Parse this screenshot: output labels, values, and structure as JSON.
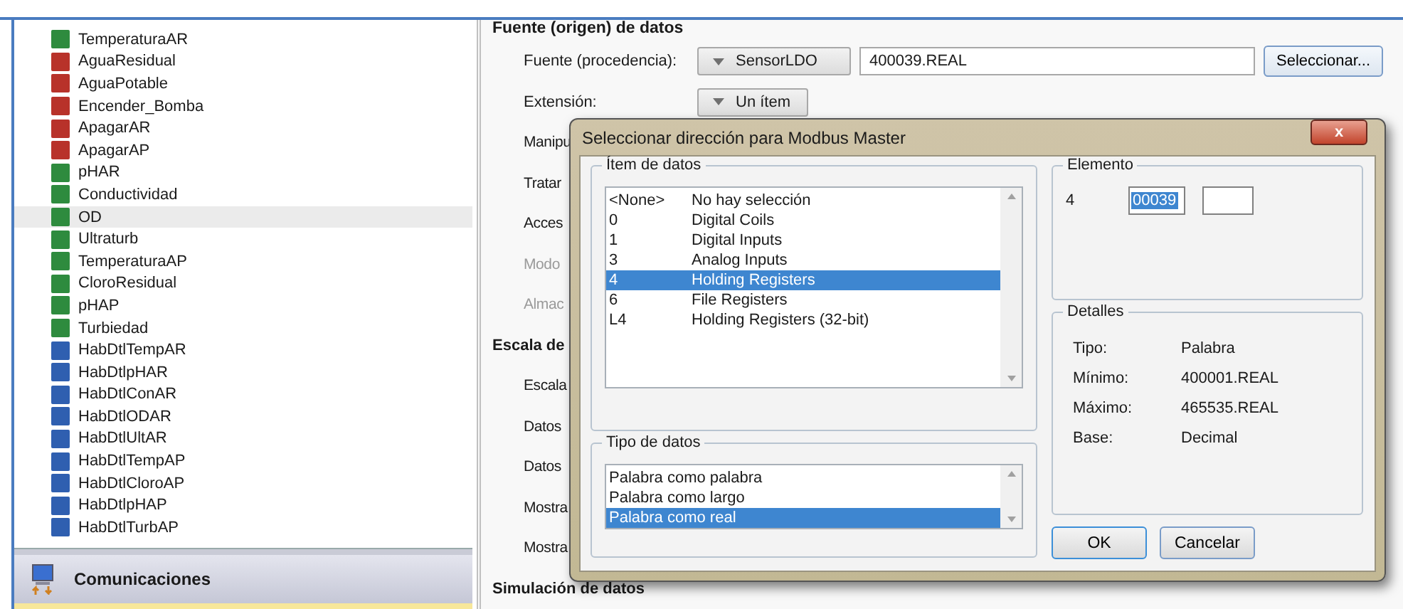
{
  "tree": {
    "items": [
      {
        "label": "TemperaturaAR",
        "kind": "analog",
        "selected": false
      },
      {
        "label": "AguaResidual",
        "kind": "digital",
        "selected": false
      },
      {
        "label": "AguaPotable",
        "kind": "digital",
        "selected": false
      },
      {
        "label": "Encender_Bomba",
        "kind": "digital",
        "selected": false
      },
      {
        "label": "ApagarAR",
        "kind": "digital",
        "selected": false
      },
      {
        "label": "ApagarAP",
        "kind": "digital",
        "selected": false
      },
      {
        "label": "pHAR",
        "kind": "analog",
        "selected": false
      },
      {
        "label": "Conductividad",
        "kind": "analog",
        "selected": false
      },
      {
        "label": "OD",
        "kind": "analog",
        "selected": true
      },
      {
        "label": "Ultraturb",
        "kind": "analog",
        "selected": false
      },
      {
        "label": "TemperaturaAP",
        "kind": "analog",
        "selected": false
      },
      {
        "label": "CloroResidual",
        "kind": "analog",
        "selected": false
      },
      {
        "label": "pHAP",
        "kind": "analog",
        "selected": false
      },
      {
        "label": "Turbiedad",
        "kind": "analog",
        "selected": false
      },
      {
        "label": "HabDtlTempAR",
        "kind": "enable",
        "selected": false
      },
      {
        "label": "HabDtlpHAR",
        "kind": "enable",
        "selected": false
      },
      {
        "label": "HabDtlConAR",
        "kind": "enable",
        "selected": false
      },
      {
        "label": "HabDtlODAR",
        "kind": "enable",
        "selected": false
      },
      {
        "label": "HabDtlUltAR",
        "kind": "enable",
        "selected": false
      },
      {
        "label": "HabDtlTempAP",
        "kind": "enable",
        "selected": false
      },
      {
        "label": "HabDtlCloroAP",
        "kind": "enable",
        "selected": false
      },
      {
        "label": "HabDtlpHAP",
        "kind": "enable",
        "selected": false
      },
      {
        "label": "HabDtlTurbAP",
        "kind": "enable",
        "selected": false
      }
    ],
    "section": "Comunicaciones"
  },
  "form": {
    "heading": "Fuente (origen) de datos",
    "source_label": "Fuente (procedencia):",
    "source_dropdown": "SensorLDO",
    "source_value": "400039.REAL",
    "select_button": "Seleccionar...",
    "extension_label": "Extensión:",
    "extension_dropdown": "Un ítem",
    "rows": [
      {
        "label": "Manipu",
        "kind": "label",
        "disabled": false
      },
      {
        "label": "Tratar",
        "kind": "label",
        "disabled": false
      },
      {
        "label": "Acces",
        "kind": "label",
        "disabled": false
      },
      {
        "label": "Modo",
        "kind": "label",
        "disabled": true
      },
      {
        "label": "Almac",
        "kind": "label",
        "disabled": true
      },
      {
        "label": "Escala de",
        "kind": "heading",
        "disabled": false
      },
      {
        "label": "Escala",
        "kind": "label",
        "disabled": false
      },
      {
        "label": "Datos",
        "kind": "label",
        "disabled": false
      },
      {
        "label": "Datos",
        "kind": "label",
        "disabled": false
      },
      {
        "label": "Mostra",
        "kind": "label",
        "disabled": false
      },
      {
        "label": "Mostra",
        "kind": "label",
        "disabled": false
      },
      {
        "label": "Simulación de datos",
        "kind": "heading",
        "disabled": false
      }
    ]
  },
  "dialog": {
    "title": "Seleccionar dirección para Modbus Master",
    "close": "x",
    "data_items": {
      "title": "Ítem de datos",
      "items": [
        {
          "code": "<None>",
          "name": "No hay selección",
          "selected": false
        },
        {
          "code": "0",
          "name": "Digital Coils",
          "selected": false
        },
        {
          "code": "1",
          "name": "Digital Inputs",
          "selected": false
        },
        {
          "code": "3",
          "name": "Analog Inputs",
          "selected": false
        },
        {
          "code": "4",
          "name": "Holding Registers",
          "selected": true
        },
        {
          "code": "6",
          "name": "File Registers",
          "selected": false
        },
        {
          "code": "L4",
          "name": "Holding Registers (32-bit)",
          "selected": false
        }
      ]
    },
    "data_type": {
      "title": "Tipo de datos",
      "items": [
        {
          "label": "Palabra como palabra",
          "selected": false
        },
        {
          "label": "Palabra como largo",
          "selected": false
        },
        {
          "label": "Palabra como real",
          "selected": true
        }
      ]
    },
    "element": {
      "title": "Elemento",
      "prefix": "4",
      "value": "00039"
    },
    "details": {
      "title": "Detalles",
      "rows": [
        {
          "label": "Tipo:",
          "value": "Palabra"
        },
        {
          "label": "Mínimo:",
          "value": "400001.REAL"
        },
        {
          "label": "Máximo:",
          "value": "465535.REAL"
        },
        {
          "label": "Base:",
          "value": "Decimal"
        }
      ]
    },
    "buttons": [
      "OK",
      "Cancelar"
    ]
  }
}
